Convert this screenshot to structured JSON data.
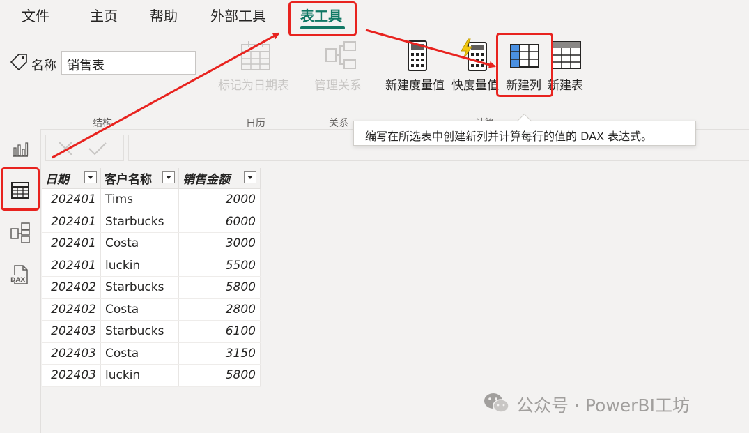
{
  "menu": {
    "items": [
      "文件",
      "主页",
      "帮助",
      "外部工具",
      "表工具"
    ],
    "active": "表工具"
  },
  "ribbon": {
    "name_label": "名称",
    "name_value": "销售表",
    "buttons": {
      "mark_date": "标记为日期表",
      "manage_rel": "管理关系",
      "new_measure": "新建度量值",
      "quick_measure": "快度量值",
      "new_column": "新建列",
      "new_table": "新建表"
    },
    "groups": {
      "structure": "结构",
      "calendar": "日历",
      "relationships": "关系",
      "calculations": "计算"
    }
  },
  "tooltip": "编写在所选表中创建新列并计算每行的值的 DAX 表达式。",
  "table": {
    "headers": [
      "日期",
      "客户名称",
      "销售金额"
    ],
    "rows": [
      [
        "202401",
        "Tims",
        "2000"
      ],
      [
        "202401",
        "Starbucks",
        "6000"
      ],
      [
        "202401",
        "Costa",
        "3000"
      ],
      [
        "202401",
        "luckin",
        "5500"
      ],
      [
        "202402",
        "Starbucks",
        "5800"
      ],
      [
        "202402",
        "Costa",
        "2800"
      ],
      [
        "202403",
        "Starbucks",
        "6100"
      ],
      [
        "202403",
        "Costa",
        "3150"
      ],
      [
        "202403",
        "luckin",
        "5800"
      ]
    ]
  },
  "watermark": "公众号 · PowerBI工坊",
  "colors": {
    "accent": "#117865",
    "highlight": "#e8231f",
    "background": "#f3f2f1"
  },
  "icons": {
    "name_tag": "tag-icon",
    "mark_date": "calendar-table-icon",
    "manage_rel": "relationships-icon",
    "new_measure": "calculator-icon",
    "quick_measure": "lightning-calculator-icon",
    "new_column": "new-column-icon",
    "new_table": "new-table-icon",
    "nav_report": "bar-chart-icon",
    "nav_data": "table-grid-icon",
    "nav_model": "model-icon",
    "nav_dax": "dax-query-icon",
    "cancel": "close-icon",
    "commit": "check-icon"
  }
}
